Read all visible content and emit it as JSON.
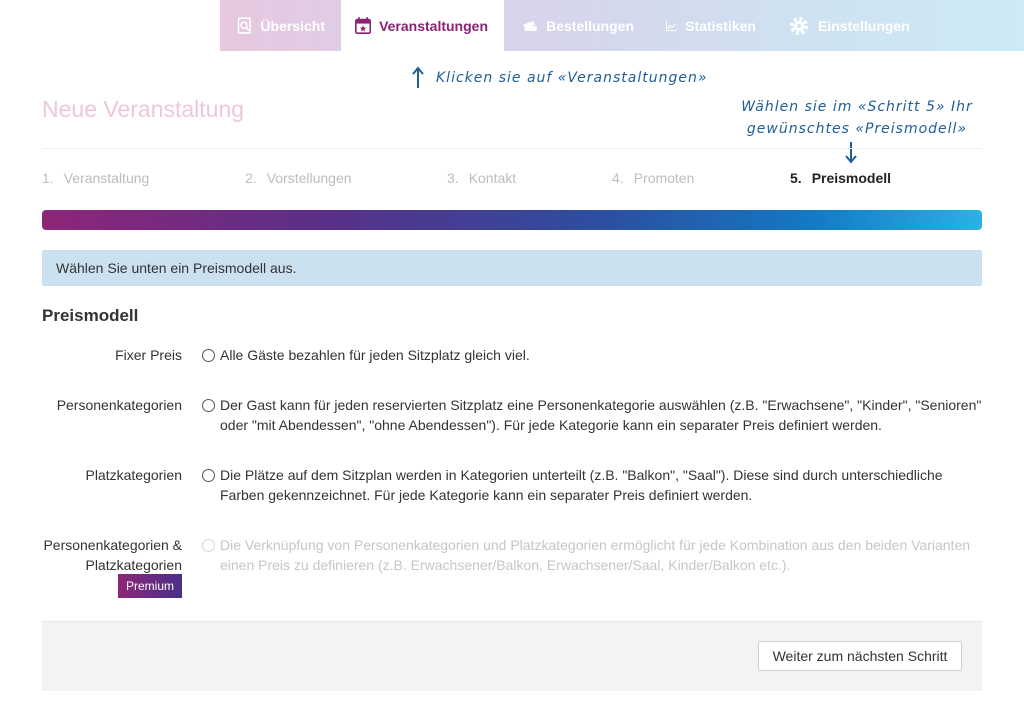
{
  "nav": {
    "tabs": [
      {
        "label": "Übersicht",
        "icon": "search-document-icon"
      },
      {
        "label": "Veranstaltungen",
        "icon": "calendar-star-icon"
      },
      {
        "label": "Bestellungen",
        "icon": "tickets-icon"
      },
      {
        "label": "Statistiken",
        "icon": "chart-line-icon"
      },
      {
        "label": "Einstellungen",
        "icon": "gear-icon"
      }
    ]
  },
  "annotations": {
    "note1": "Klicken sie auf «Veranstaltungen»",
    "note2": "Wählen sie im «Schritt 5» Ihr gewünschtes «Preismodell»"
  },
  "page": {
    "title": "Neue Veranstaltung"
  },
  "steps": [
    {
      "num": "1.",
      "label": "Veranstaltung"
    },
    {
      "num": "2.",
      "label": "Vorstellungen"
    },
    {
      "num": "3.",
      "label": "Kontakt"
    },
    {
      "num": "4.",
      "label": "Promoten"
    },
    {
      "num": "5.",
      "label": "Preismodell"
    }
  ],
  "info": "Wählen Sie unten ein Preismodell aus.",
  "section_title": "Preismodell",
  "options": [
    {
      "label": "Fixer Preis",
      "text": "Alle Gäste bezahlen für jeden Sitzplatz gleich viel."
    },
    {
      "label": "Personenkategorien",
      "text": "Der Gast kann für jeden reservierten Sitzplatz eine Personenkategorie auswählen (z.B. \"Erwachsene\", \"Kinder\", \"Senioren\" oder \"mit Abendessen\", \"ohne Abendessen\"). Für jede Kategorie kann ein separater Preis definiert werden."
    },
    {
      "label": "Platzkategorien",
      "text": "Die Plätze auf dem Sitzplan werden in Kategorien unterteilt (z.B. \"Balkon\", \"Saal\"). Diese sind durch unterschiedliche Farben gekennzeichnet. Für jede Kategorie kann ein separater Preis definiert werden."
    },
    {
      "label": "Personenkategorien & Platzkategorien",
      "text": "Die Verknüpfung von Personenkategorien und Platzkategorien ermöglicht für jede Kombination aus den beiden Varianten einen Preis zu definieren (z.B. Erwachsener/Balkon, Erwachsener/Saal, Kinder/Balkon etc.).",
      "badge": "Premium"
    }
  ],
  "footer": {
    "next_label": "Weiter zum nächsten Schritt"
  }
}
